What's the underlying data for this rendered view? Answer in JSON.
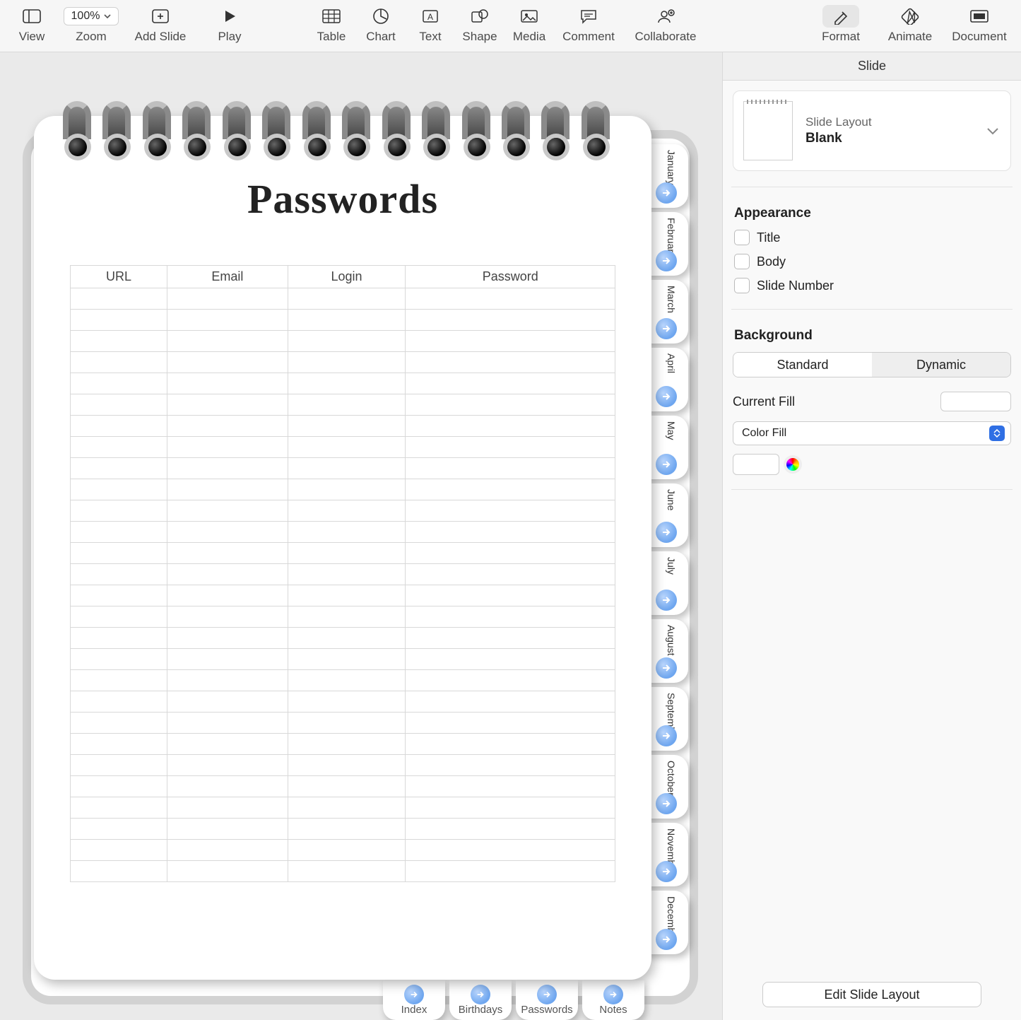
{
  "toolbar": {
    "view": "View",
    "zoom_label": "Zoom",
    "zoom_value": "100%",
    "add_slide": "Add Slide",
    "play": "Play",
    "table": "Table",
    "chart": "Chart",
    "text": "Text",
    "shape": "Shape",
    "media": "Media",
    "comment": "Comment",
    "collaborate": "Collaborate",
    "format": "Format",
    "animate": "Animate",
    "document": "Document"
  },
  "slide": {
    "title": "Passwords",
    "columns": [
      "URL",
      "Email",
      "Login",
      "Password"
    ],
    "side_tabs": [
      "January",
      "February",
      "March",
      "April",
      "May",
      "June",
      "July",
      "August",
      "September",
      "October",
      "November",
      "December"
    ],
    "bottom_tabs": [
      "Index",
      "Birthdays",
      "Passwords",
      "Notes"
    ]
  },
  "inspector": {
    "header": "Slide",
    "layout_label": "Slide Layout",
    "layout_value": "Blank",
    "appearance_title": "Appearance",
    "appearance_checks": [
      "Title",
      "Body",
      "Slide Number"
    ],
    "background_title": "Background",
    "seg_standard": "Standard",
    "seg_dynamic": "Dynamic",
    "current_fill": "Current Fill",
    "fill_select": "Color Fill",
    "edit_layout": "Edit Slide Layout"
  }
}
